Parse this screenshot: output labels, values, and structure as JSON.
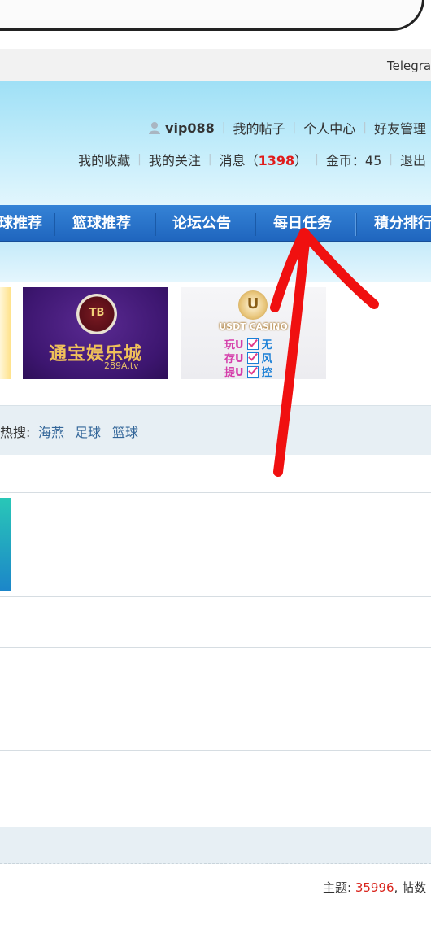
{
  "topbar": {
    "telegram_text": "Telegra"
  },
  "user_panel": {
    "username": "vip088",
    "links_row1": [
      "我的帖子",
      "个人中心",
      "好友管理"
    ],
    "favorites": "我的收藏",
    "follows": "我的关注",
    "messages_label": "消息（",
    "messages_count": "1398",
    "messages_close": "）",
    "coins_label": "金币：",
    "coins_value": "45",
    "logout": "退出"
  },
  "nav": {
    "items": [
      "球推荐",
      "篮球推荐",
      "论坛公告",
      "每日任务",
      "積分排行"
    ],
    "accent_color": "#2872cc"
  },
  "ads": {
    "tongbao": {
      "logo_text": "TB",
      "name": "通宝娱乐城",
      "url": "289A.tv"
    },
    "usdt": {
      "title": "USDT CASINO",
      "lines": [
        {
          "left": "玩U",
          "right": "无"
        },
        {
          "left": "存U",
          "right": "风"
        },
        {
          "left": "提U",
          "right": "控"
        }
      ]
    }
  },
  "hot_search": {
    "label": "热搜:",
    "terms": [
      "海燕",
      "足球",
      "篮球"
    ]
  },
  "stats": {
    "topics_label": "主题: ",
    "topics_value": "35996",
    "posts_label": ", 帖数"
  }
}
